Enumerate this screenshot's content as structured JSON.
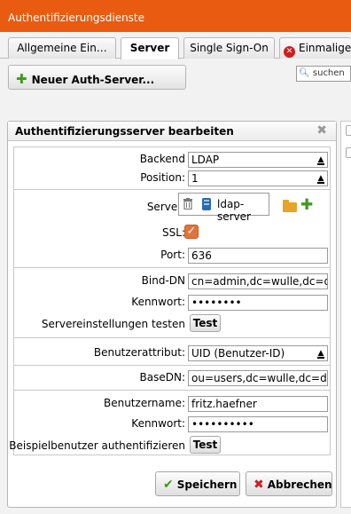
{
  "window": {
    "title": "Authentifizierungsdienste"
  },
  "tabs": [
    {
      "label": "Allgemeine Ein…"
    },
    {
      "label": "Server"
    },
    {
      "label": "Single Sign-On"
    },
    {
      "label": "Einmalige"
    }
  ],
  "toolbar": {
    "new_server_label": "Neuer Auth-Server...",
    "search_placeholder": "suchen"
  },
  "dialog": {
    "title": "Authentifizierungsserver bearbeiten",
    "backend": {
      "label": "Backend",
      "value": "LDAP"
    },
    "position": {
      "label": "Position:",
      "value": "1"
    },
    "server": {
      "label": "Server:",
      "value": "ldap-server"
    },
    "ssl": {
      "label": "SSL:",
      "checked": true
    },
    "port": {
      "label": "Port:",
      "value": "636"
    },
    "bind_dn": {
      "label": "Bind-DN",
      "value": "cn=admin,dc=wulle,dc=de"
    },
    "password": {
      "label": "Kennwort:",
      "value": "••••••••"
    },
    "test_server": {
      "label": "Servereinstellungen testen",
      "button": "Test"
    },
    "user_attribute": {
      "label": "Benutzerattribut:",
      "value": "UID (Benutzer-ID)"
    },
    "base_dn": {
      "label": "BaseDN:",
      "value": "ou=users,dc=wulle,dc=de"
    },
    "username": {
      "label": "Benutzername:",
      "value": "fritz.haefner"
    },
    "user_password": {
      "label": "Kennwort:",
      "value": "••••••••••"
    },
    "test_user": {
      "label": "Beispielbenutzer authentifizieren",
      "button": "Test"
    },
    "save_label": "Speichern",
    "cancel_label": "Abbrechen"
  },
  "colors": {
    "accent": "#e95b10",
    "ok": "#3c9c1d",
    "error": "#cc1f1f"
  }
}
